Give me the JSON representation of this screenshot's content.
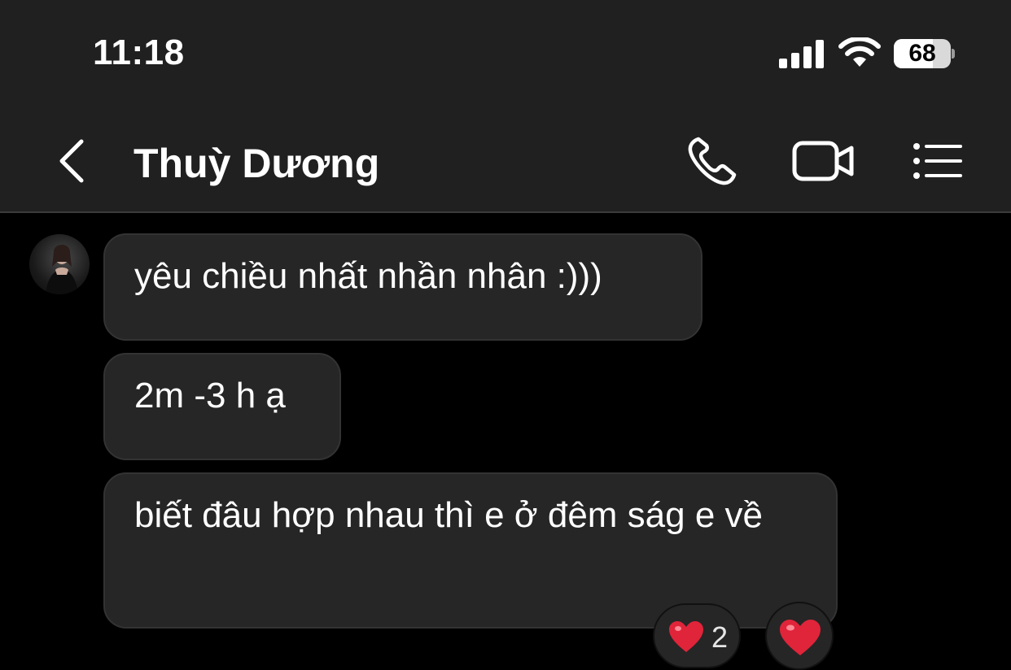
{
  "status_bar": {
    "time": "11:18",
    "battery": "68",
    "battery_level_percent": 68,
    "icons": [
      "cellular-signal-icon",
      "wifi-icon",
      "battery-icon"
    ]
  },
  "header": {
    "contact_name": "Thuỳ Dương",
    "icons": [
      "back-chevron-icon",
      "phone-icon",
      "video-camera-icon",
      "list-menu-icon"
    ]
  },
  "messages": [
    {
      "text": "yêu chiều nhất nhần nhân :)))"
    },
    {
      "text": "2m -3 h ạ"
    },
    {
      "text": "biết đâu hợp nhau thì e ở đêm ság e về"
    }
  ],
  "reactions": {
    "emoji": "heart",
    "count": "2"
  },
  "colors": {
    "background": "#000000",
    "header_bg": "#202020",
    "bubble_bg": "#262626",
    "heart": "#e0243a"
  }
}
